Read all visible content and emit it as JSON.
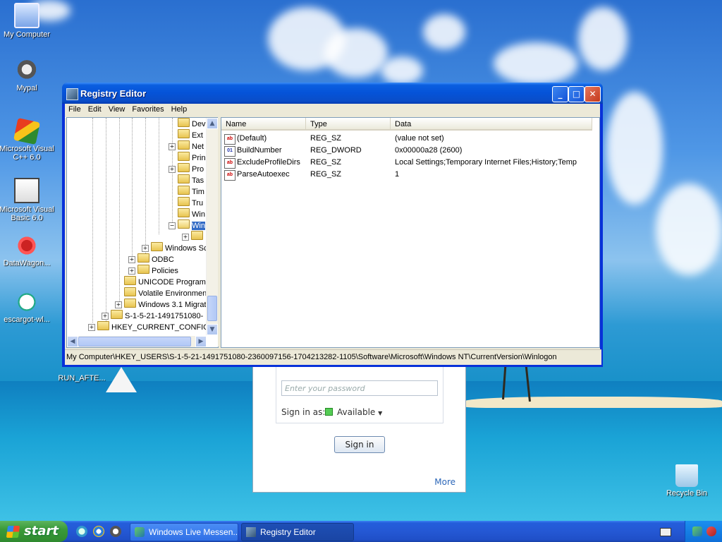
{
  "desktop": {
    "icons": [
      {
        "label": "My Computer",
        "icon": "my-computer-icon"
      },
      {
        "label": "Mypal",
        "icon": "mypal-icon"
      },
      {
        "label": "Microsoft Visual C++ 6.0",
        "icon": "visual-cpp-icon"
      },
      {
        "label": "Microsoft Visual Basic 6.0",
        "icon": "visual-basic-icon"
      },
      {
        "label": "DataWagon...",
        "icon": "datawagon-icon"
      },
      {
        "label": "escargot-wl...",
        "icon": "escargot-icon"
      },
      {
        "label": "RUN_AFTE...",
        "icon": "file-icon"
      },
      {
        "label": "Recycle Bin",
        "icon": "recycle-bin-icon"
      }
    ]
  },
  "messenger": {
    "password_placeholder": "Enter your password",
    "sign_in_as_label": "Sign in as:",
    "status": "Available",
    "sign_in_button": "Sign in",
    "more_link": "More"
  },
  "regedit": {
    "title": "Registry Editor",
    "menu": [
      "File",
      "Edit",
      "View",
      "Favorites",
      "Help"
    ],
    "tree": [
      {
        "label": "Dev",
        "expander": ""
      },
      {
        "label": "Ext",
        "expander": ""
      },
      {
        "label": "Net",
        "expander": "+"
      },
      {
        "label": "Prin",
        "expander": ""
      },
      {
        "label": "Pro",
        "expander": "+"
      },
      {
        "label": "Tas",
        "expander": ""
      },
      {
        "label": "Tim",
        "expander": ""
      },
      {
        "label": "Tru",
        "expander": ""
      },
      {
        "label": "Win",
        "expander": ""
      },
      {
        "label": "Win",
        "expander": "-",
        "selected": true
      },
      {
        "label": "",
        "expander": "+"
      },
      {
        "label": "Windows Sc",
        "expander": "+"
      },
      {
        "label": "ODBC",
        "expander": "+"
      },
      {
        "label": "Policies",
        "expander": "+"
      },
      {
        "label": "UNICODE Program",
        "expander": ""
      },
      {
        "label": "Volatile Environmen",
        "expander": ""
      },
      {
        "label": "Windows 3.1 Migrat",
        "expander": "+"
      },
      {
        "label": "S-1-5-21-1491751080-",
        "expander": "+"
      },
      {
        "label": "HKEY_CURRENT_CONFIG",
        "expander": "+"
      }
    ],
    "columns": {
      "name": "Name",
      "type": "Type",
      "data": "Data"
    },
    "values": [
      {
        "name": "(Default)",
        "type": "REG_SZ",
        "data": "(value not set)",
        "icon": "string-value-icon"
      },
      {
        "name": "BuildNumber",
        "type": "REG_DWORD",
        "data": "0x00000a28 (2600)",
        "icon": "binary-value-icon"
      },
      {
        "name": "ExcludeProfileDirs",
        "type": "REG_SZ",
        "data": "Local Settings;Temporary Internet Files;History;Temp",
        "icon": "string-value-icon"
      },
      {
        "name": "ParseAutoexec",
        "type": "REG_SZ",
        "data": "1",
        "icon": "string-value-icon"
      }
    ],
    "status_path": "My Computer\\HKEY_USERS\\S-1-5-21-1491751080-2360097156-1704213282-1105\\Software\\Microsoft\\Windows NT\\CurrentVersion\\Winlogon"
  },
  "taskbar": {
    "start_label": "start",
    "tasks": [
      {
        "label": "Windows Live Messen...",
        "active": false
      },
      {
        "label": "Registry Editor",
        "active": true
      }
    ]
  },
  "colors": {
    "titlebar_blue": "#0553d8",
    "taskbar_blue": "#2458d4",
    "start_green": "#3a9a3a",
    "selection_blue": "#316ac5"
  }
}
